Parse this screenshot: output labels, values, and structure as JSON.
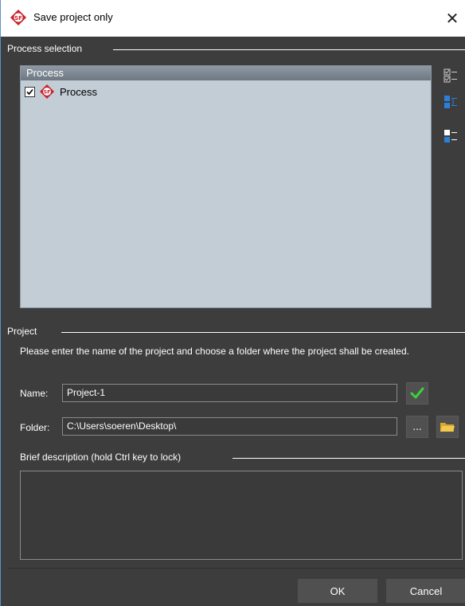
{
  "window": {
    "title": "Save project only",
    "close_glyph": "✕"
  },
  "process_selection": {
    "title": "Process selection",
    "column_header": "Process",
    "items": [
      {
        "label": "Process",
        "checked": true
      }
    ]
  },
  "project": {
    "title": "Project",
    "instructions": "Please enter the name of the project and choose a folder where the project shall be created.",
    "name_label": "Name:",
    "name_value": "Project-1",
    "folder_label": "Folder:",
    "folder_value": "C:\\Users\\soeren\\Desktop\\",
    "browse_label": "..."
  },
  "description": {
    "title": "Brief description (hold Ctrl key to lock)",
    "value": ""
  },
  "buttons": {
    "ok": "OK",
    "cancel": "Cancel"
  },
  "colors": {
    "accent_red": "#c8232c",
    "check_green": "#3bd13b",
    "folder_yellow": "#f2c94c",
    "side_icon_blue": "#2c7fd9"
  },
  "icons": [
    "app-logo-icon",
    "close-icon",
    "check-all-icon",
    "tree-expand-icon",
    "invert-selection-icon",
    "checkmark-icon",
    "folder-icon"
  ]
}
